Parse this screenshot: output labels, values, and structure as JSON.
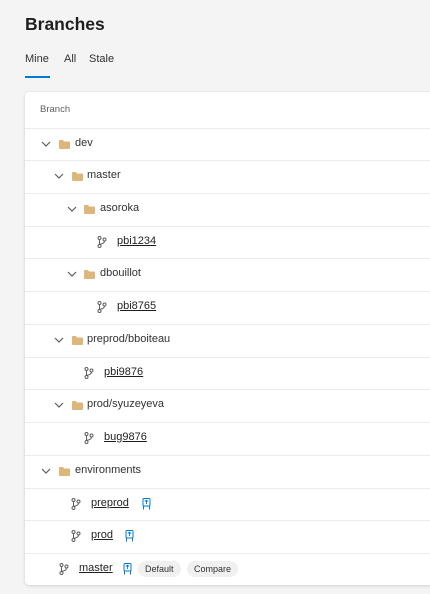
{
  "page": {
    "title": "Branches"
  },
  "tabs": [
    {
      "label": "Mine",
      "selected": true
    },
    {
      "label": "All",
      "selected": false
    },
    {
      "label": "Stale",
      "selected": false
    }
  ],
  "table": {
    "column_header": "Branch"
  },
  "tree": [
    {
      "type": "folder",
      "label": "dev",
      "expanded": true
    },
    {
      "type": "folder",
      "label": "master",
      "expanded": true
    },
    {
      "type": "folder",
      "label": "asoroka",
      "expanded": true
    },
    {
      "type": "branch",
      "label": "pbi1234"
    },
    {
      "type": "folder",
      "label": "dbouillot",
      "expanded": true
    },
    {
      "type": "branch",
      "label": "pbi8765"
    },
    {
      "type": "folder",
      "label": "preprod/bboiteau",
      "expanded": true
    },
    {
      "type": "branch",
      "label": "pbi9876"
    },
    {
      "type": "folder",
      "label": "prod/syuzeyeva",
      "expanded": true
    },
    {
      "type": "branch",
      "label": "bug9876"
    },
    {
      "type": "folder",
      "label": "environments",
      "expanded": true
    },
    {
      "type": "branch",
      "label": "preprod",
      "policy_icon": "policy-icon"
    },
    {
      "type": "branch",
      "label": "prod",
      "policy_icon": "policy-icon"
    },
    {
      "type": "branch",
      "label": "master",
      "policy_icon": "policy-icon",
      "default_badge": "Default",
      "compare_badge": "Compare"
    }
  ],
  "colors": {
    "accent": "#0078d4",
    "folder": "#dcb67a",
    "policy": "#0078d4"
  }
}
